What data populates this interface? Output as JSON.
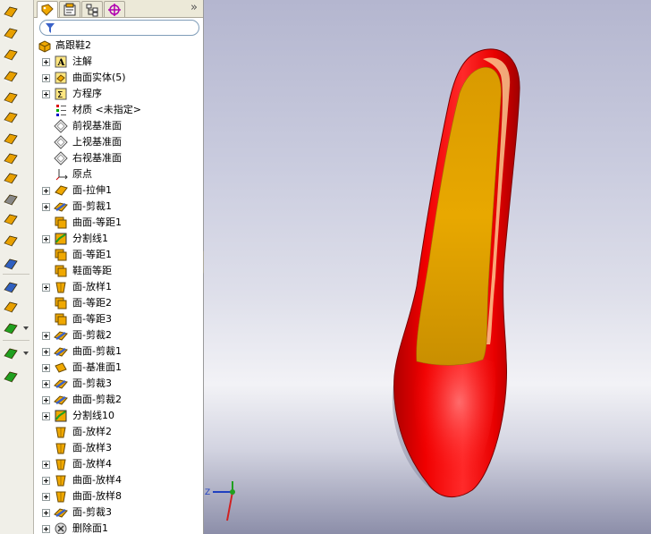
{
  "toolbar": {
    "buttons": [
      {
        "icon": "extruded-surface-icon",
        "color": "#e8a000"
      },
      {
        "icon": "revolved-surface-icon",
        "color": "#e8a000"
      },
      {
        "icon": "swept-surface-icon",
        "color": "#e8a000"
      },
      {
        "icon": "lofted-surface-icon",
        "color": "#e8a000"
      },
      {
        "icon": "boundary-surface-icon",
        "color": "#e8a000"
      },
      {
        "icon": "filled-surface-icon",
        "color": "#e8a000"
      },
      {
        "icon": "planar-surface-icon",
        "color": "#e8a000"
      },
      {
        "icon": "offset-surface-icon",
        "color": "#e8a000"
      },
      {
        "icon": "ruled-surface-icon",
        "color": "#e8a000"
      },
      {
        "icon": "delete-face-icon",
        "color": "#888888"
      },
      {
        "icon": "surface-body-icon",
        "color": "#e8a000"
      },
      {
        "icon": "extend-surface-icon",
        "color": "#e8a000"
      },
      {
        "icon": "trim-surface-icon",
        "color": "#3060c0"
      },
      {
        "icon": "untrim-surface-icon",
        "color": "#3060c0"
      },
      {
        "icon": "knit-surface-icon",
        "color": "#e8a000"
      },
      {
        "icon": "thicken-icon",
        "color": "#20a020"
      },
      {
        "icon": "curve-tools-icon",
        "color": "#20a020"
      },
      {
        "icon": "split-line-icon",
        "color": "#20a020"
      }
    ]
  },
  "tabs": [
    {
      "name": "featuremanager-tab",
      "icon": "featuremanager-icon"
    },
    {
      "name": "propertymanager-tab",
      "icon": "propertymanager-icon"
    },
    {
      "name": "configurationmanager-tab",
      "icon": "configurationmanager-icon"
    },
    {
      "name": "dimxpert-tab",
      "icon": "dimxpert-icon"
    }
  ],
  "tabs_more": "»",
  "tree": {
    "root": {
      "label": "高跟鞋2",
      "icon": "part-icon"
    },
    "items": [
      {
        "label": "注解",
        "icon": "annotations-icon",
        "expandable": true
      },
      {
        "label": "曲面实体(5)",
        "icon": "surface-bodies-icon",
        "expandable": true
      },
      {
        "label": "方程序",
        "icon": "equations-icon",
        "expandable": true
      },
      {
        "label": "材质 <未指定>",
        "icon": "material-icon",
        "expandable": false
      },
      {
        "label": "前视基准面",
        "icon": "plane-icon",
        "expandable": false
      },
      {
        "label": "上视基准面",
        "icon": "plane-icon",
        "expandable": false
      },
      {
        "label": "右视基准面",
        "icon": "plane-icon",
        "expandable": false
      },
      {
        "label": "原点",
        "icon": "origin-icon",
        "expandable": false
      },
      {
        "label": "面-拉伸1",
        "icon": "extrude-surface-icon",
        "expandable": true
      },
      {
        "label": "面-剪裁1",
        "icon": "trim-surface-icon",
        "expandable": true
      },
      {
        "label": "曲面-等距1",
        "icon": "offset-surface-icon",
        "expandable": false
      },
      {
        "label": "分割线1",
        "icon": "split-line-icon",
        "expandable": true
      },
      {
        "label": "面-等距1",
        "icon": "offset-surface-icon",
        "expandable": false
      },
      {
        "label": "鞋面等距",
        "icon": "offset-surface-icon",
        "expandable": false
      },
      {
        "label": "面-放样1",
        "icon": "loft-surface-icon",
        "expandable": true
      },
      {
        "label": "面-等距2",
        "icon": "offset-surface-icon",
        "expandable": false
      },
      {
        "label": "面-等距3",
        "icon": "offset-surface-icon",
        "expandable": false
      },
      {
        "label": "面-剪裁2",
        "icon": "trim-surface-icon",
        "expandable": true
      },
      {
        "label": "曲面-剪裁1",
        "icon": "trim-surface-icon",
        "expandable": true
      },
      {
        "label": "面-基准面1",
        "icon": "planar-surface-icon",
        "expandable": true
      },
      {
        "label": "面-剪裁3",
        "icon": "trim-surface-icon",
        "expandable": true
      },
      {
        "label": "曲面-剪裁2",
        "icon": "trim-surface-icon",
        "expandable": true
      },
      {
        "label": "分割线10",
        "icon": "split-line-icon",
        "expandable": true
      },
      {
        "label": "面-放样2",
        "icon": "loft-surface-icon",
        "expandable": false
      },
      {
        "label": "面-放样3",
        "icon": "loft-surface-icon",
        "expandable": false
      },
      {
        "label": "面-放样4",
        "icon": "loft-surface-icon",
        "expandable": true
      },
      {
        "label": "曲面-放样4",
        "icon": "loft-surface-icon",
        "expandable": true
      },
      {
        "label": "曲面-放样8",
        "icon": "loft-surface-icon",
        "expandable": true
      },
      {
        "label": "面-剪裁3",
        "icon": "trim-surface-icon",
        "expandable": true
      },
      {
        "label": "删除面1",
        "icon": "delete-face-icon",
        "expandable": true
      }
    ]
  },
  "triad": {
    "z_label": "Z"
  },
  "colors": {
    "shoe_body": "#e60000",
    "insole": "#e6a800",
    "surface_icon": "#f0a800",
    "trim_icon": "#3a62c8",
    "split_icon": "#20a020"
  }
}
